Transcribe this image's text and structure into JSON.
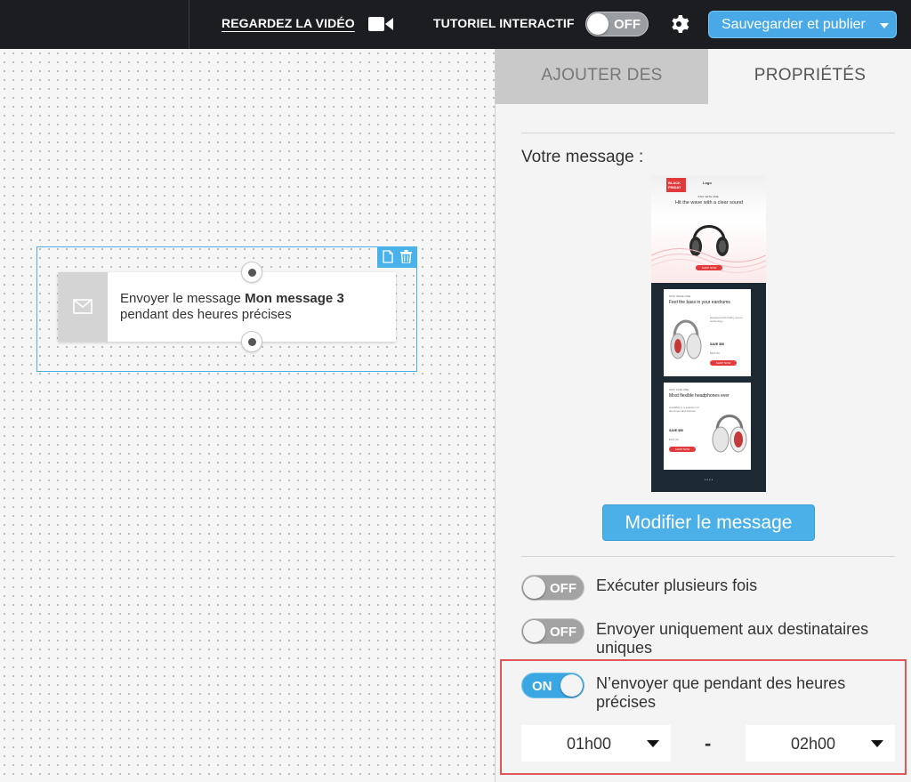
{
  "topbar": {
    "video_link": "REGARDEZ LA VIDÉO",
    "tutorial_label": "TUTORIEL INTERACTIF",
    "tutorial_toggle": "OFF",
    "publish_button": "Sauvegarder et publier"
  },
  "canvas": {
    "node": {
      "text_prefix": "Envoyer le message ",
      "message_name": "Mon message 3",
      "line2": "pendant des heures précises"
    }
  },
  "panel": {
    "tabs": [
      {
        "label": "AJOUTER DES",
        "active": false
      },
      {
        "label": "PROPRIÉTÉS",
        "active": true
      }
    ],
    "message_label": "Votre message :",
    "preview": {
      "badge": "BLACK FRIDAY",
      "logo": "Logo",
      "tagline": "STAY WITH ONE",
      "headline": "Hit the wave with a clear sound",
      "cta": "SHOP NOW",
      "card1": {
        "tag": "STAY WAVE ONE",
        "title": "Feel the bass in your eardrums",
        "text": "Equipped with Dolby sound technology",
        "save": "SAVE $50",
        "price": "$227.00",
        "cta": "SHOP NOW"
      },
      "card2": {
        "tag": "STAY FIVE ONE",
        "title": "Most flexible headphones ever",
        "text": "Available in a selection of aluminum and titanium",
        "save": "SAVE $50",
        "price": "$127.00",
        "cta": "SHOP NOW"
      }
    },
    "edit_button": "Modifier le message",
    "options": [
      {
        "state": "OFF",
        "label": "Exécuter plusieurs fois"
      },
      {
        "state": "OFF",
        "label": "Envoyer uniquement aux destinataires uniques"
      },
      {
        "state": "ON",
        "label": "N’envoyer que pendant des heures précises"
      }
    ],
    "time_from": "01h00",
    "time_separator": "-",
    "time_to": "02h00"
  },
  "colors": {
    "accent": "#48a9e6",
    "highlight": "#e05555",
    "topbar": "#1b1d21"
  }
}
